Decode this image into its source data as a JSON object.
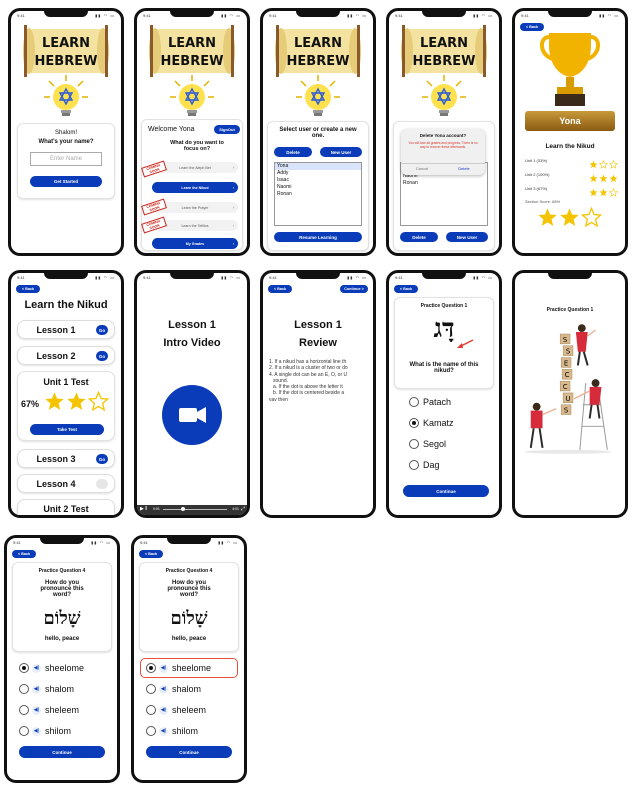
{
  "status_time": "9:41",
  "logo_text": [
    "LEARN",
    "HEBREW"
  ],
  "back_label": "< Back",
  "screen_welcome": {
    "greeting": "Shalom!",
    "question": "What's your name?",
    "name_placeholder": "Enter Name",
    "button": "Get Started"
  },
  "screen_focus": {
    "welcome": "Welcome Yona",
    "signout": "SignOut",
    "question": "What do you want to focus on?",
    "items": [
      {
        "label": "Learn the Aleph Bet",
        "badge": "COMING SOON"
      },
      {
        "label": "Learn the Nikud",
        "badge": ""
      },
      {
        "label": "Learn the Prayer",
        "badge": "COMING SOON"
      },
      {
        "label": "Learn the Tefillos",
        "badge": "COMING SOON"
      },
      {
        "label": "My Grades",
        "badge": ""
      }
    ]
  },
  "screen_users": {
    "title": "Select user or create a new one.",
    "delete": "Delete",
    "new_user": "New User",
    "users": [
      "Yona",
      "Addy",
      "Isaac",
      "Naomi",
      "Ronan"
    ],
    "resume": "Resume Learning"
  },
  "screen_delete": {
    "dialog_title": "Delete Yona account?",
    "dialog_body": "You will lose all grades and progress. There is no way to recover these afterwards.",
    "cancel": "Cancel",
    "confirm": "Delete",
    "users": [
      "Naomi",
      "Ronan"
    ],
    "delete": "Delete",
    "new_user": "New User"
  },
  "screen_trophy": {
    "name": "Yona",
    "title": "Learn the Nikud",
    "units": [
      {
        "label": "Unit 1 (33%)",
        "stars": 1
      },
      {
        "label": "Unit 2 (100%)",
        "stars": 3
      },
      {
        "label": "Unit 3 (67%)",
        "stars": 2
      }
    ],
    "section_score": "Section Score: 68%",
    "section_stars": 2
  },
  "screen_nikud": {
    "title": "Learn the Nikud",
    "lessons": [
      "Lesson 1",
      "Lesson 2"
    ],
    "unit_test": "Unit 1 Test",
    "test_percent": "67%",
    "test_stars": 2,
    "take_test": "Take Test",
    "more": [
      "Lesson 3",
      "Lesson 4"
    ],
    "unit2": "Unit 2 Test",
    "go": "Go"
  },
  "screen_video": {
    "title": "Lesson 1",
    "subtitle": "Intro Video",
    "time_start": "0:01",
    "time_end": "4:01"
  },
  "screen_review": {
    "continue": "Continue >",
    "title": "Lesson 1",
    "subtitle": "Review",
    "lines": [
      "1. If a nikud has a horizontal line th",
      "2. If a nikud is a cluster of two or do",
      "4. A single dot can be an E, O, or U",
      "sound.",
      "a. If the dot is above the letter it",
      "b. If the dot is centered beside a",
      "vav then"
    ]
  },
  "screen_pq1": {
    "title": "Practice Question 1",
    "letters": "דָּג",
    "question": "What is the name of this nikud?",
    "options": [
      "Patach",
      "Kamatz",
      "Segol",
      "Dag"
    ],
    "selected": 1,
    "continue": "Continue"
  },
  "screen_success": {
    "title": "Practice Question 1",
    "blocks": [
      "S",
      "U",
      "C",
      "C",
      "E",
      "S",
      "S"
    ]
  },
  "screen_pq4a": {
    "title": "Practice Question 4",
    "question": "How do you pronounce this word?",
    "word": "שָׁלוֹם",
    "meaning": "hello, peace",
    "options": [
      "sheelome",
      "shalom",
      "sheleem",
      "shilom"
    ],
    "selected": 0,
    "continue": "Continue"
  },
  "screen_pq4b": {
    "title": "Practice Question 4",
    "question": "How do you pronounce this word?",
    "word": "שָׁלוֹם",
    "meaning": "hello, peace",
    "options": [
      "sheelome",
      "shalom",
      "sheleem",
      "shilom"
    ],
    "selected": 0,
    "continue": "Continue"
  },
  "colors": {
    "primary": "#0a3bb8",
    "gold": "#f5c400",
    "wrong": "#e8503a"
  }
}
